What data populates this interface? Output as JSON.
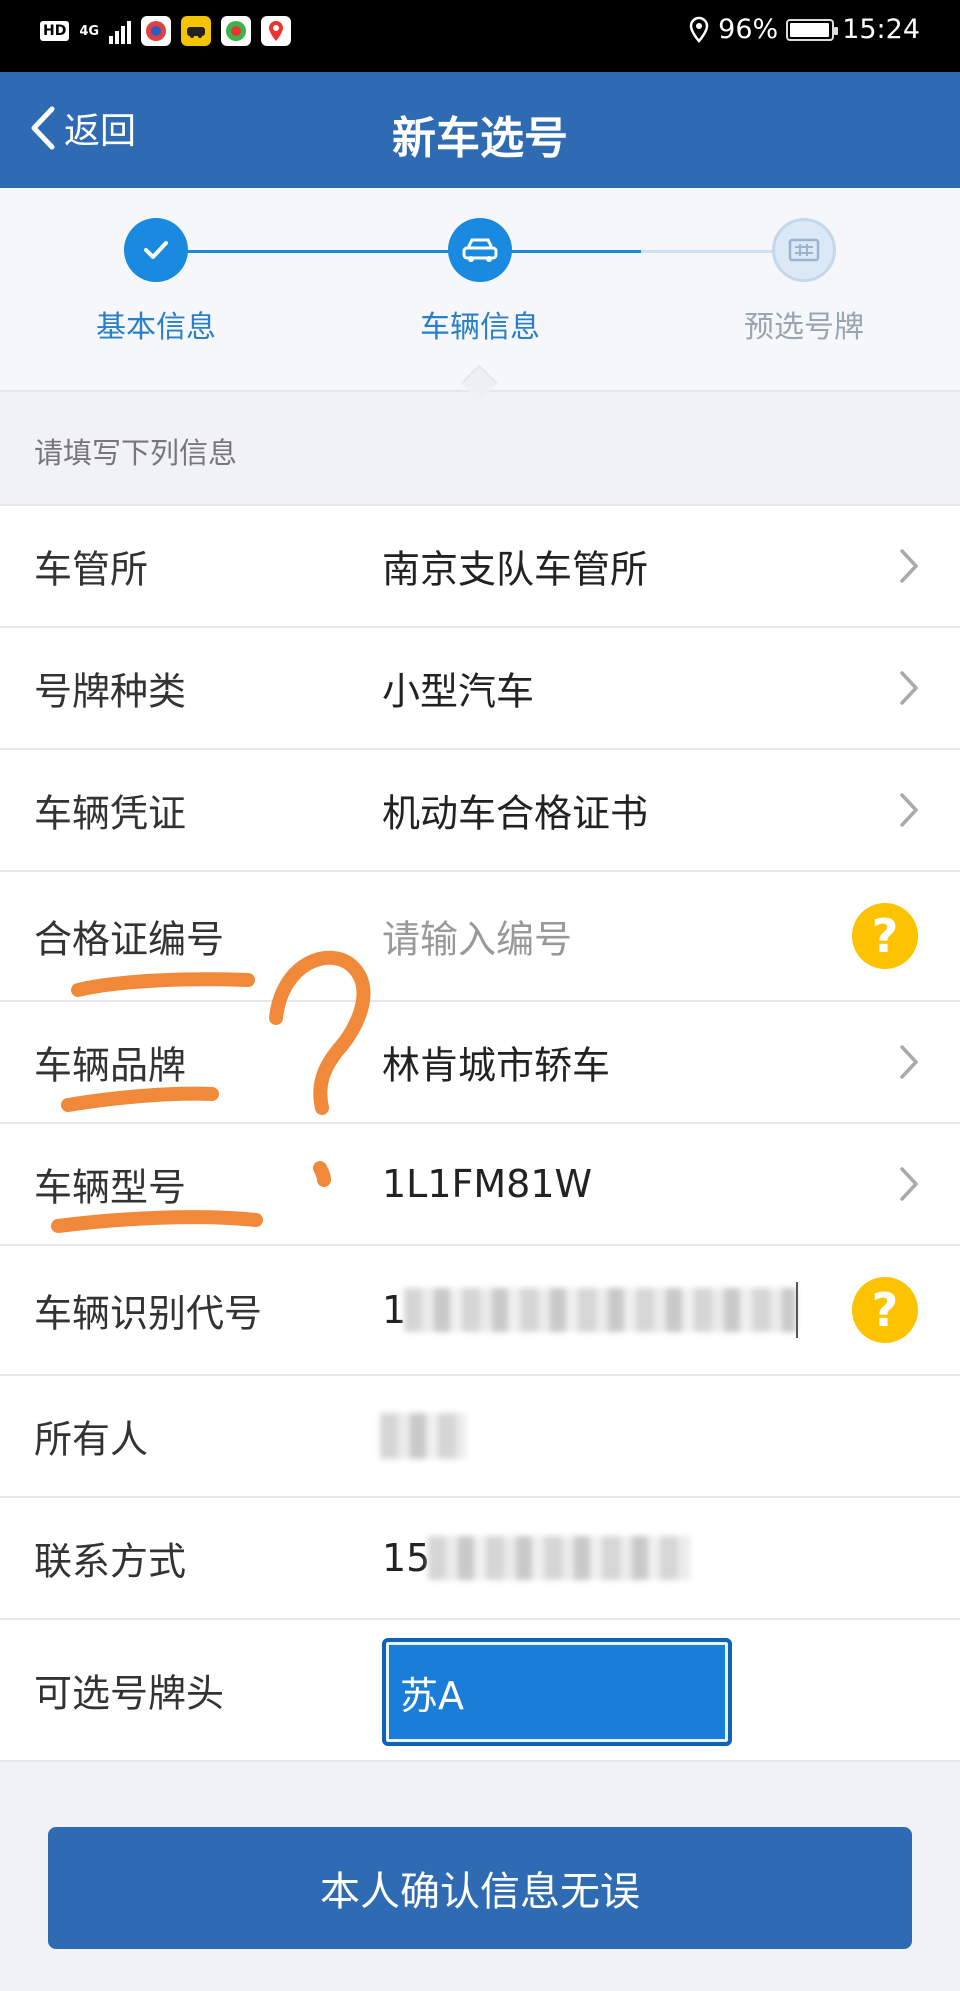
{
  "status_bar": {
    "hd": "HD",
    "network": "4G",
    "battery": "96%",
    "battery_level": 0.96,
    "time": "15:24"
  },
  "header": {
    "back_label": "返回",
    "title": "新车选号"
  },
  "steps": [
    {
      "label": "基本信息",
      "state": "done",
      "icon": "check-icon"
    },
    {
      "label": "车辆信息",
      "state": "active",
      "icon": "car-icon"
    },
    {
      "label": "预选号牌",
      "state": "pending",
      "icon": "plate-icon"
    }
  ],
  "hint": "请填写下列信息",
  "form": {
    "office": {
      "label": "车管所",
      "value": "南京支队车管所"
    },
    "plate_type": {
      "label": "号牌种类",
      "value": "小型汽车"
    },
    "vehicle_doc": {
      "label": "车辆凭证",
      "value": "机动车合格证书"
    },
    "cert_no": {
      "label": "合格证编号",
      "placeholder": "请输入编号"
    },
    "brand": {
      "label": "车辆品牌",
      "value": "林肯城市轿车"
    },
    "model": {
      "label": "车辆型号",
      "value": "1L1FM81W"
    },
    "vin": {
      "label": "车辆识别代号",
      "value_visible": "1L"
    },
    "owner": {
      "label": "所有人"
    },
    "contact": {
      "label": "联系方式",
      "value_visible": "15"
    },
    "prefix": {
      "label": "可选号牌头",
      "value": "苏A"
    }
  },
  "confirm_label": "本人确认信息无误",
  "colors": {
    "primary": "#2f6bb3",
    "step_active": "#1a8ae0",
    "step_pending": "#c9dcef",
    "help": "#fdc300",
    "annotation": "#f0893a"
  }
}
